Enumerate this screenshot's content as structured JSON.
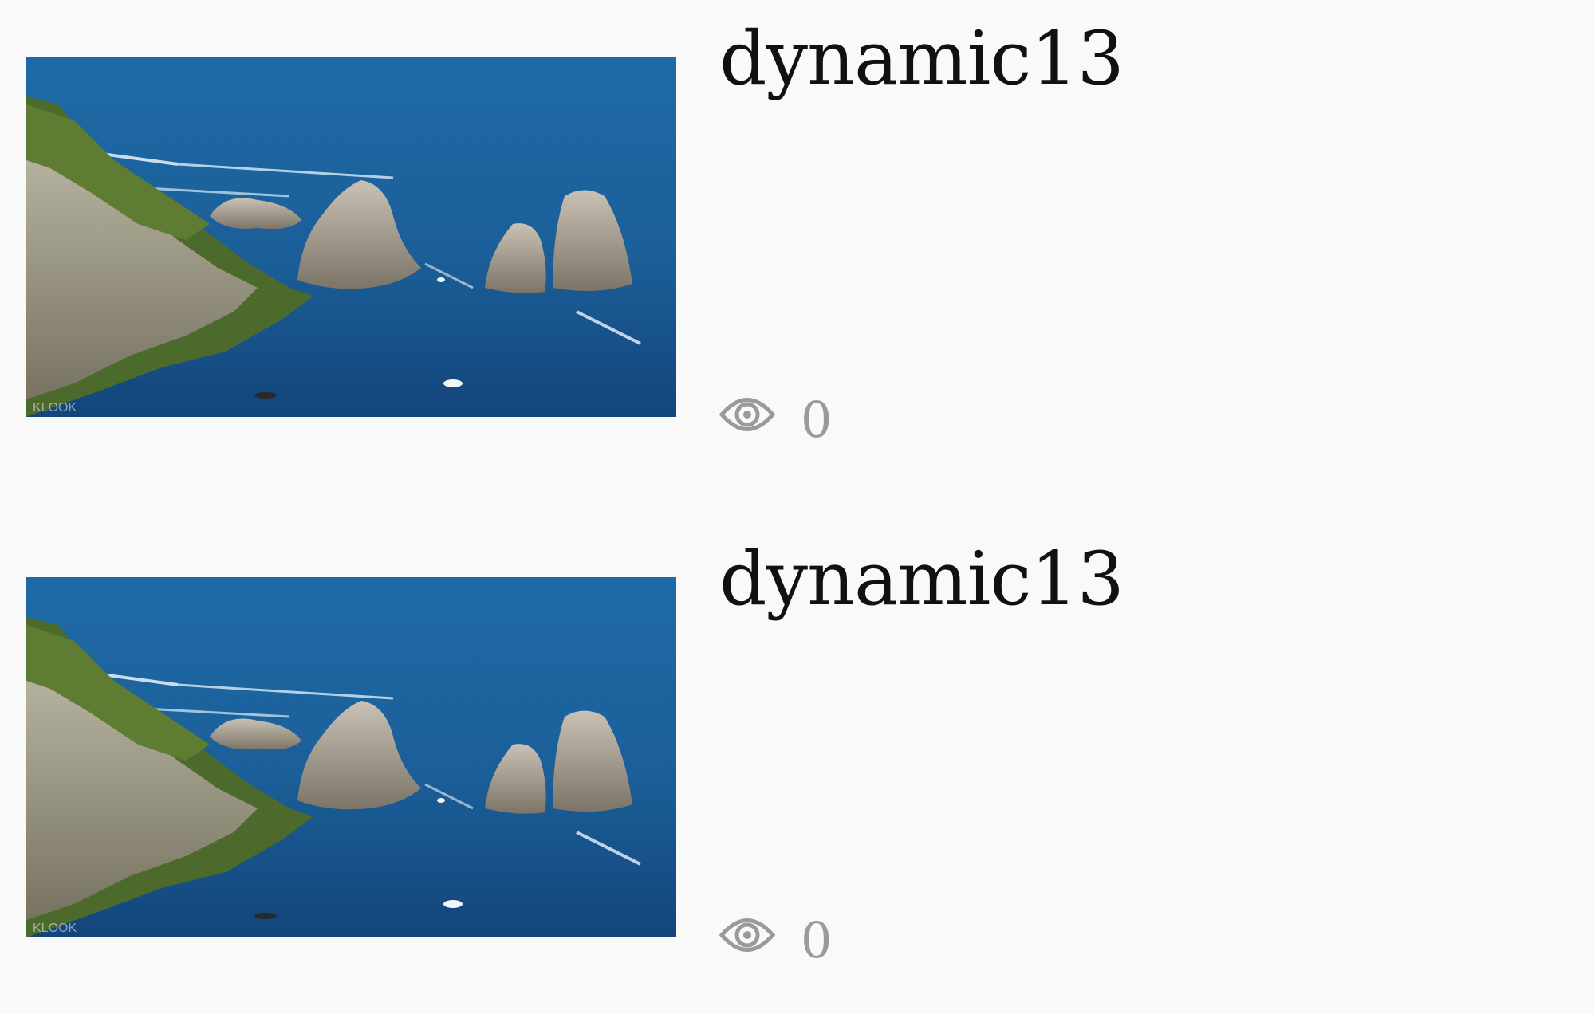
{
  "posts": [
    {
      "title": "dynamic13",
      "views": "0",
      "image_watermark": "KLOOK"
    },
    {
      "title": "dynamic13",
      "views": "0",
      "image_watermark": "KLOOK"
    }
  ],
  "icons": {
    "views": "eye-icon"
  },
  "colors": {
    "background": "#f9f9f9",
    "title": "#111111",
    "meta": "#9a9a9a",
    "sea": "#1f6aa6"
  }
}
